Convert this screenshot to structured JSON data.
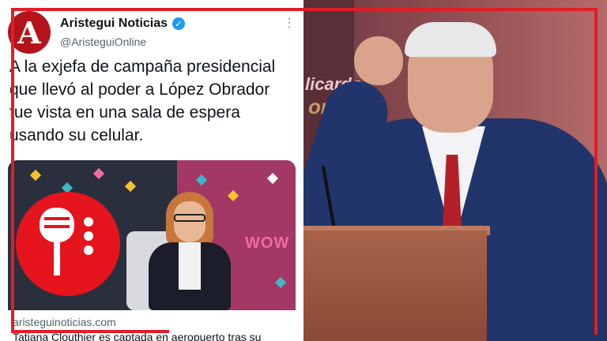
{
  "tweet": {
    "avatar_letter": "A",
    "display_name": "Aristegui Noticias",
    "handle": "@AristeguiOnline",
    "text": "A la exjefa de campaña presidencial que llevó al poder a López Obrador fue vista en una sala de espera usando su celular.",
    "verified_icon": "verified-badge-icon",
    "more_icon": "more-options-icon"
  },
  "card": {
    "wall_text": "WOW",
    "domain": "aristeguinoticias.com",
    "title": "Tatiana Clouthier es captada en aeropuerto tras su"
  },
  "photo": {
    "backdrop_text_1": "licardo",
    "backdrop_text_2": "ores"
  },
  "colors": {
    "brand_red": "#e01e26",
    "verified_blue": "#1d9bf0",
    "suit_navy": "#21346b"
  }
}
